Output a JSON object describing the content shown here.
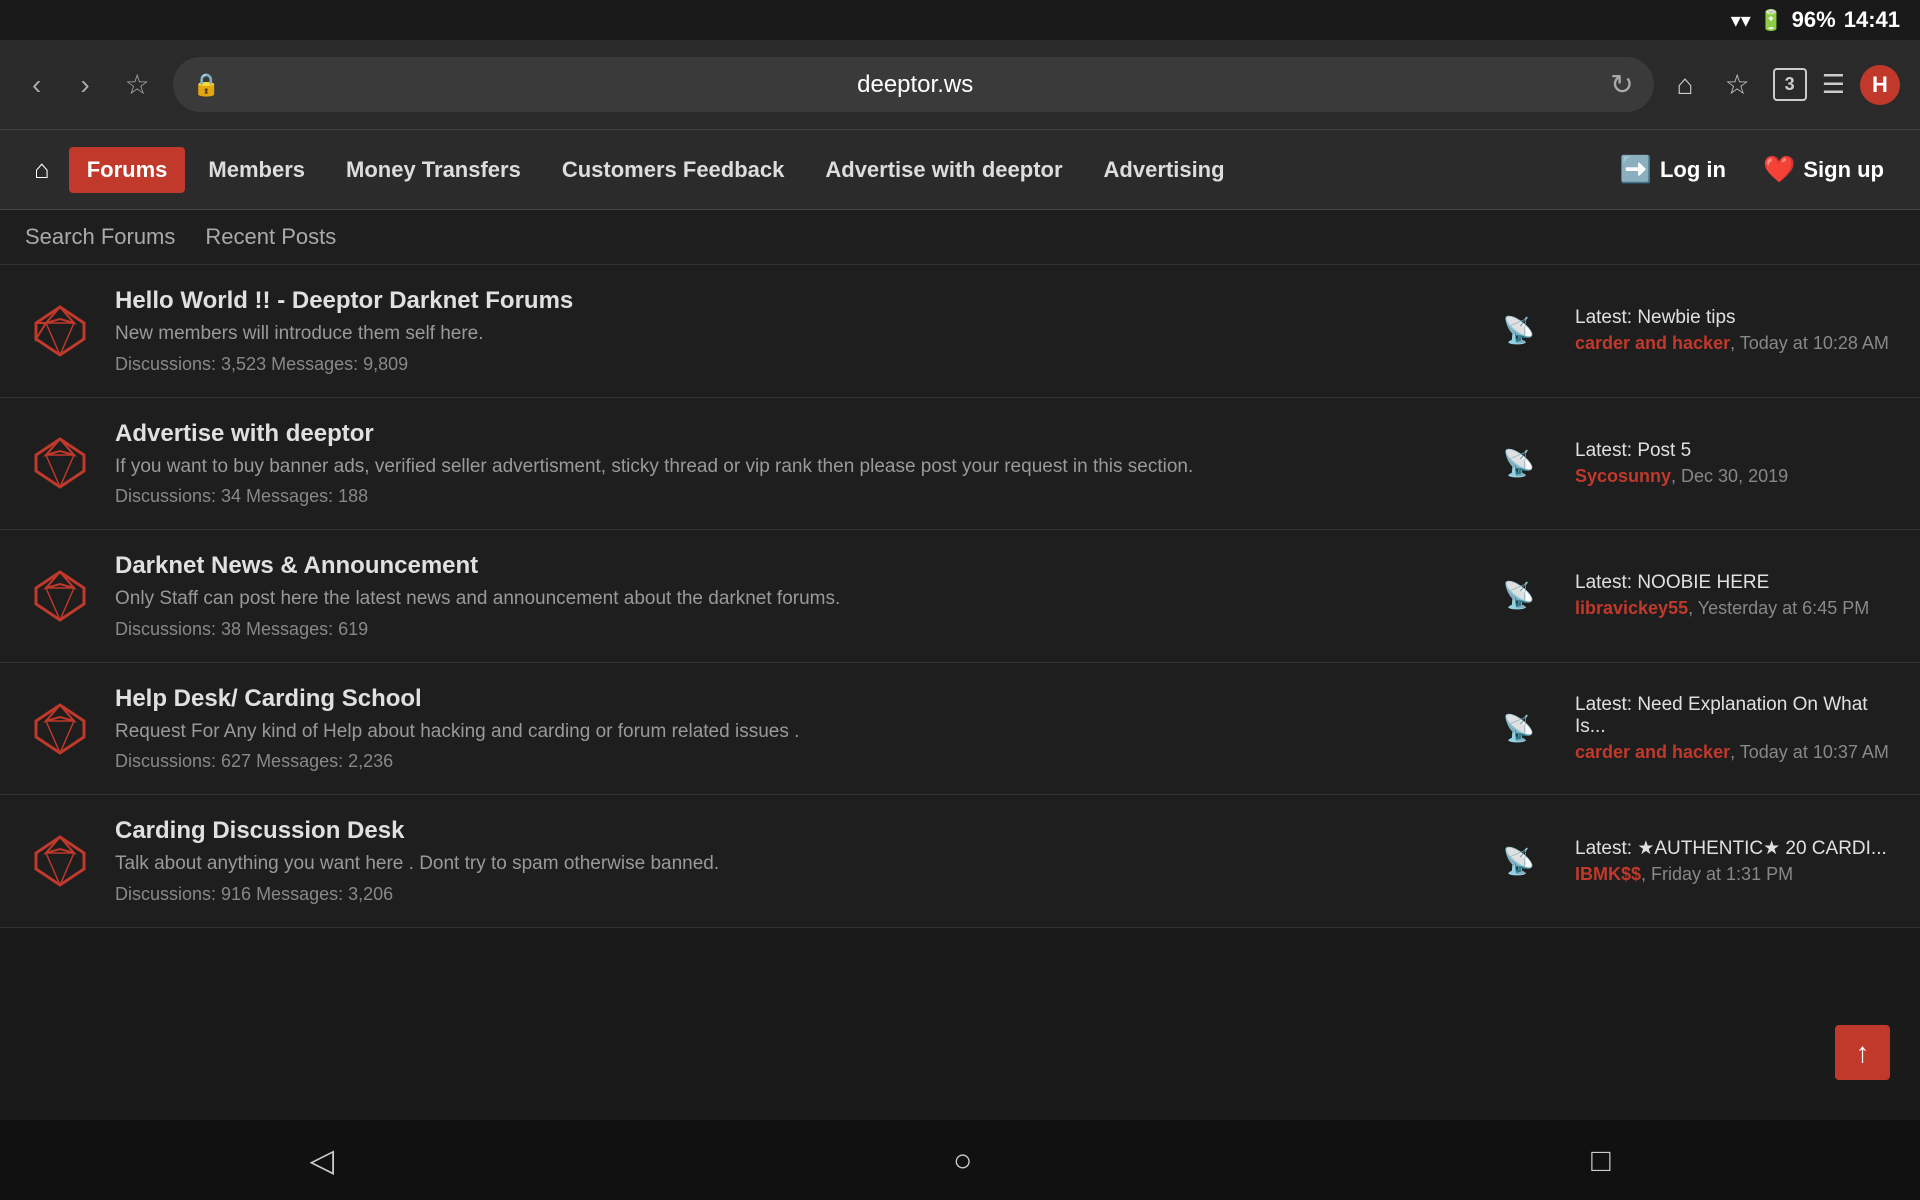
{
  "statusBar": {
    "battery": "96%",
    "time": "14:41"
  },
  "browserBar": {
    "url": "deeptor.ws",
    "tabCount": "3",
    "menuLabel": "H"
  },
  "nav": {
    "homeIcon": "🏠",
    "items": [
      {
        "label": "Forums",
        "active": true
      },
      {
        "label": "Members",
        "active": false
      },
      {
        "label": "Money Transfers",
        "active": false
      },
      {
        "label": "Customers Feedback",
        "active": false
      },
      {
        "label": "Advertise with deeptor",
        "active": false
      },
      {
        "label": "Advertising",
        "active": false
      }
    ],
    "loginLabel": "Log in",
    "signupLabel": "Sign up"
  },
  "subNav": {
    "items": [
      {
        "label": "Search Forums"
      },
      {
        "label": "Recent Posts"
      }
    ]
  },
  "forums": [
    {
      "title": "Hello World !! - Deeptor Darknet Forums",
      "desc": "New members will introduce them self here.",
      "discussions": "3,523",
      "messages": "9,809",
      "latestTitle": "Newbie tips",
      "latestUser": "carder and hacker",
      "latestTime": "Today at 10:28 AM"
    },
    {
      "title": "Advertise with deeptor",
      "desc": "If you want to buy banner ads, verified seller advertisment, sticky thread or vip rank then please post your request in this section.",
      "discussions": "34",
      "messages": "188",
      "latestTitle": "Post 5",
      "latestUser": "Sycosunny",
      "latestTime": "Dec 30, 2019"
    },
    {
      "title": "Darknet News & Announcement",
      "desc": "Only Staff can post here the latest news and announcement about the darknet forums.",
      "discussions": "38",
      "messages": "619",
      "latestTitle": "NOOBIE HERE",
      "latestUser": "libravickey55",
      "latestTime": "Yesterday at 6:45 PM"
    },
    {
      "title": "Help Desk/ Carding School",
      "desc": "Request For Any kind of Help about hacking and carding or forum related issues .",
      "discussions": "627",
      "messages": "2,236",
      "latestTitle": "Need Explanation On What Is...",
      "latestUser": "carder and hacker",
      "latestTime": "Today at 10:37 AM"
    },
    {
      "title": "Carding Discussion Desk",
      "desc": "Talk about anything you want here . Dont try to spam otherwise banned.",
      "discussions": "916",
      "messages": "3,206",
      "latestTitle": "★AUTHENTIC★ 20 CARDI...",
      "latestUser": "IBMK$$",
      "latestTime": "Friday at 1:31 PM"
    }
  ],
  "scrollTopBtn": "↑",
  "androidNav": {
    "back": "◁",
    "home": "○",
    "recent": "□"
  }
}
